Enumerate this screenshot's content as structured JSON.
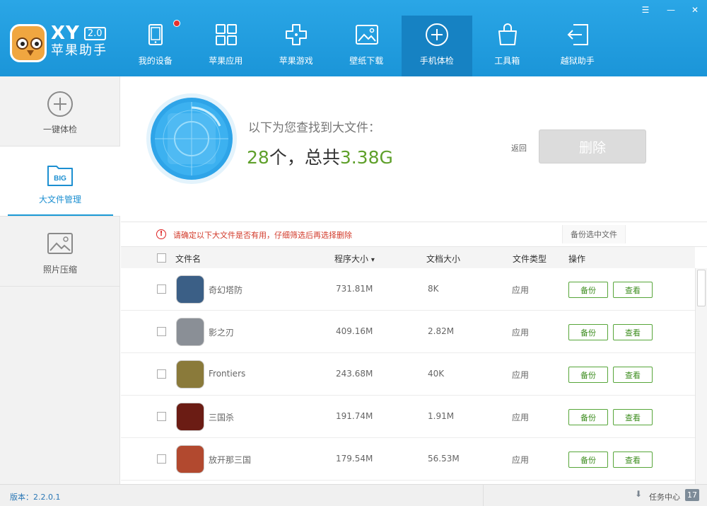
{
  "app": {
    "brand": "XY",
    "version_badge": "2.0",
    "name": "苹果助手"
  },
  "window_controls": {
    "menu": "☰",
    "minimize": "—",
    "close": "✕"
  },
  "nav": [
    {
      "label": "我的设备",
      "icon": "device-icon",
      "has_dot": true
    },
    {
      "label": "苹果应用",
      "icon": "apps-grid-icon"
    },
    {
      "label": "苹果游戏",
      "icon": "gamepad-icon"
    },
    {
      "label": "壁纸下载",
      "icon": "wallpaper-icon"
    },
    {
      "label": "手机体检",
      "icon": "checkup-plus-icon",
      "active": true
    },
    {
      "label": "工具箱",
      "icon": "toolbox-icon"
    },
    {
      "label": "越狱助手",
      "icon": "jailbreak-icon"
    }
  ],
  "sidebar": {
    "items": [
      {
        "label": "一键体检",
        "icon": "plus-circle-icon"
      },
      {
        "label": "大文件管理",
        "icon": "big-file-icon",
        "badge": "BIG",
        "active": true
      },
      {
        "label": "照片压缩",
        "icon": "photo-icon"
      }
    ]
  },
  "summary": {
    "caption": "以下为您查找到大文件：",
    "count": "28",
    "count_unit": "个，总共",
    "total_size": "3.38G",
    "back_label": "返回",
    "delete_label": "删除"
  },
  "warning": {
    "text": "请确定以下大文件是否有用，仔细筛选后再选择删除",
    "backup_selected_label": "备份选中文件"
  },
  "table": {
    "headers": {
      "name": "文件名",
      "program_size": "程序大小",
      "doc_size": "文档大小",
      "type": "文件类型",
      "action": "操作"
    },
    "sort_indicator": "▾",
    "rows": [
      {
        "name": "奇幻塔防",
        "program_size": "731.81M",
        "doc_size": "8K",
        "type": "应用",
        "icon_color": "#3b5f86"
      },
      {
        "name": "影之刃",
        "program_size": "409.16M",
        "doc_size": "2.82M",
        "type": "应用",
        "icon_color": "#8a8f96"
      },
      {
        "name": "Frontiers",
        "program_size": "243.68M",
        "doc_size": "40K",
        "type": "应用",
        "icon_color": "#8a7a3a"
      },
      {
        "name": "三国杀",
        "program_size": "191.74M",
        "doc_size": "1.91M",
        "type": "应用",
        "icon_color": "#6b1c14"
      },
      {
        "name": "放开那三国",
        "program_size": "179.54M",
        "doc_size": "56.53M",
        "type": "应用",
        "icon_color": "#b2492f"
      }
    ],
    "backup_label": "备份",
    "view_label": "查看"
  },
  "footer": {
    "version": "版本：2.2.0.1",
    "task_center": "任务中心",
    "task_count": "17"
  }
}
